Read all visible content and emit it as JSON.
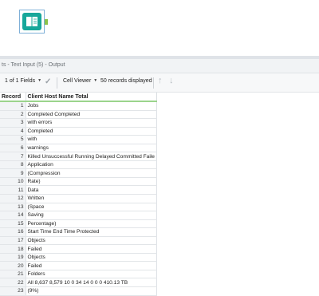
{
  "canvas": {
    "tool_name": "text-input-tool"
  },
  "results_title": "ts - Text Input (5) - Output",
  "toolbar": {
    "fields": "1 of 1 Fields",
    "viewer": "Cell Viewer",
    "records_displayed": "50 records displayed"
  },
  "columns": [
    "Record",
    "Client Host Name Total"
  ],
  "rows": [
    {
      "num": "1",
      "val": "Jobs"
    },
    {
      "num": "2",
      "val": "Completed Completed"
    },
    {
      "num": "3",
      "val": "with errors"
    },
    {
      "num": "4",
      "val": "Completed"
    },
    {
      "num": "5",
      "val": "with"
    },
    {
      "num": "6",
      "val": "warnings"
    },
    {
      "num": "7",
      "val": "Killed Unsuccessful Running Delayed Committed Faile"
    },
    {
      "num": "8",
      "val": "Application"
    },
    {
      "num": "9",
      "val": "(Compression"
    },
    {
      "num": "10",
      "val": "Rate)"
    },
    {
      "num": "11",
      "val": "Data"
    },
    {
      "num": "12",
      "val": "Written"
    },
    {
      "num": "13",
      "val": "(Space"
    },
    {
      "num": "14",
      "val": "Saving"
    },
    {
      "num": "15",
      "val": "Percentage)"
    },
    {
      "num": "16",
      "val": "Start Time End Time Protected"
    },
    {
      "num": "17",
      "val": "Objects"
    },
    {
      "num": "18",
      "val": "Failed"
    },
    {
      "num": "19",
      "val": "Objects"
    },
    {
      "num": "20",
      "val": "Failed"
    },
    {
      "num": "21",
      "val": "Folders"
    },
    {
      "num": "22",
      "val": "All 8,637 8,579 10 0 34 14 0 0 0 410.13 TB"
    },
    {
      "num": "23",
      "val": "(9%)"
    }
  ]
}
